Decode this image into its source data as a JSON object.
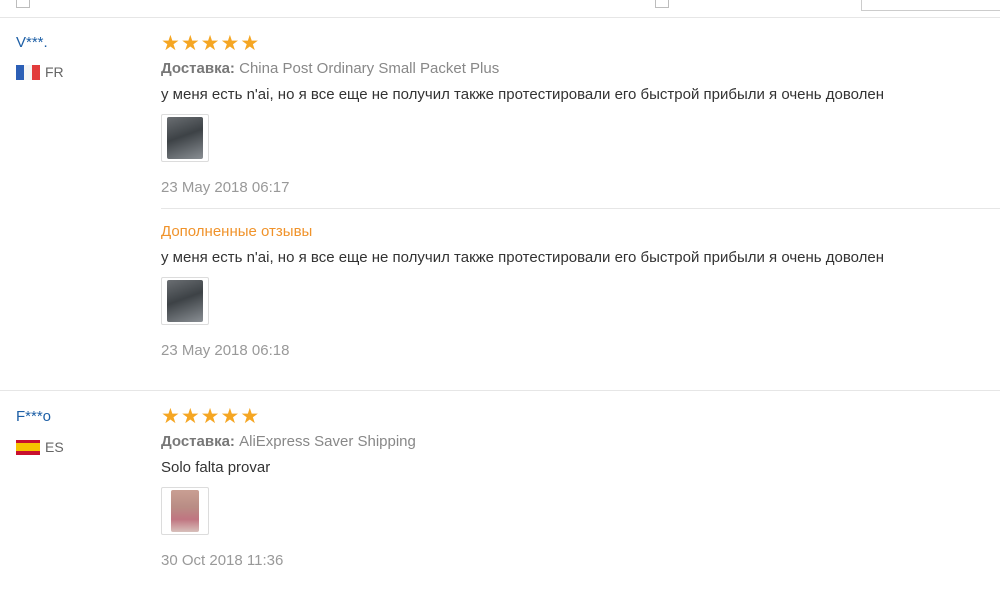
{
  "colors": {
    "star": "#f5a623",
    "username": "#1d5fa6",
    "additional_title": "#f0932b"
  },
  "reviews": [
    {
      "user": "V***.",
      "country": "FR",
      "flag_icon": "france-flag-icon",
      "rating": 5,
      "shipping_label": "Доставка:",
      "shipping_method": "China Post Ordinary Small Packet Plus",
      "text": "у меня есть n'ai, но я все еще не получил также протестировали его быстрой прибыли я очень доволен",
      "photo_icon": "review-photo-thumbnail",
      "date": "23 May 2018 06:17",
      "additional": {
        "title": "Дополненные отзывы",
        "text": "у меня есть n'ai, но я все еще не получил также протестировали его быстрой прибыли я очень доволен",
        "photo_icon": "review-photo-thumbnail",
        "date": "23 May 2018 06:18"
      }
    },
    {
      "user": "F***o",
      "country": "ES",
      "flag_icon": "spain-flag-icon",
      "rating": 5,
      "shipping_label": "Доставка:",
      "shipping_method": "AliExpress Saver Shipping",
      "text": "Solo falta provar",
      "photo_icon": "review-photo-thumbnail",
      "date": "30 Oct 2018 11:36"
    }
  ]
}
